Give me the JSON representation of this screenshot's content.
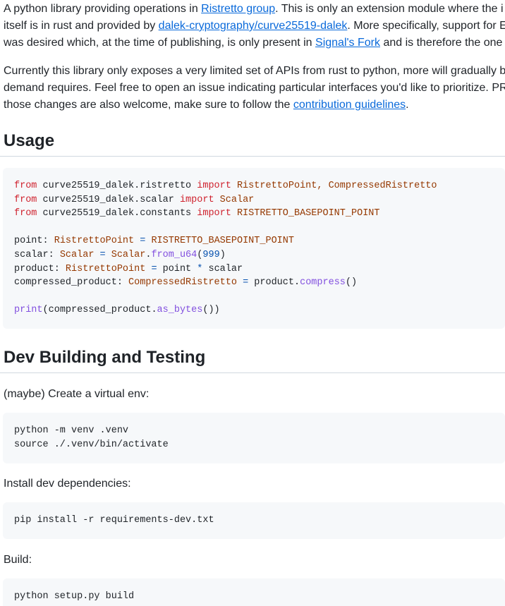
{
  "intro": {
    "p1": {
      "l1_a": "A python library providing operations in ",
      "link_ristretto": "Ristretto group",
      "l1_b": ". This is only an extension module where the i",
      "l2_a": "itself is in rust and provided by ",
      "link_dalek": "dalek-cryptography/curve25519-dalek",
      "l2_b": ". More specifically, support for E",
      "l3_a": "was desired which, at the time of publishing, is only present in ",
      "link_signal": "Signal's Fork",
      "l3_b": " and is therefore the one t"
    },
    "p2": {
      "l1": "Currently this library only exposes a very limited set of APIs from rust to python, more will gradually b",
      "l2": "demand requires. Feel free to open an issue indicating particular interfaces you'd like to prioritize. PRs",
      "l3_a": "those changes are also welcome, make sure to follow the ",
      "link_contrib": "contribution guidelines",
      "l3_b": "."
    }
  },
  "usage": {
    "heading": "Usage",
    "code": {
      "l1": {
        "from": "from",
        "mod": " curve25519_dalek.ristretto ",
        "imp": "import",
        "names": " RistrettoPoint, CompressedRistretto"
      },
      "l2": {
        "from": "from",
        "mod": " curve25519_dalek.scalar ",
        "imp": "import",
        "names": " Scalar"
      },
      "l3": {
        "from": "from",
        "mod": " curve25519_dalek.constants ",
        "imp": "import",
        "names": " RISTRETTO_BASEPOINT_POINT"
      },
      "l5": {
        "var": "point",
        "colon": ": ",
        "type": "RistrettoPoint",
        "eq": " = ",
        "val": "RISTRETTO_BASEPOINT_POINT"
      },
      "l6": {
        "var": "scalar",
        "colon": ": ",
        "type": "Scalar",
        "eq": " = ",
        "obj": "Scalar",
        "dot": ".",
        "fn": "from_u64",
        "open": "(",
        "num": "999",
        "close": ")"
      },
      "l7": {
        "var": "product",
        "colon": ": ",
        "type": "RistrettoPoint",
        "eq": " = ",
        "a": "point ",
        "mul": "*",
        "b": " scalar"
      },
      "l8": {
        "var": "compressed_product",
        "colon": ": ",
        "type": "CompressedRistretto",
        "eq": " = ",
        "obj": "product.",
        "fn": "compress",
        "args": "()"
      },
      "l10": {
        "fn": "print",
        "open": "(compressed_product.",
        "fn2": "as_bytes",
        "close": "())"
      }
    }
  },
  "dev": {
    "heading": "Dev Building and Testing",
    "step1": "(maybe) Create a virtual env:",
    "code1": {
      "l1": "python -m venv .venv",
      "l2": "source ./.venv/bin/activate"
    },
    "step2": "Install dev dependencies:",
    "code2": {
      "l1": "pip install -r requirements-dev.txt"
    },
    "step3": "Build:",
    "code3": {
      "l1": "python setup.py build"
    }
  },
  "colors": {
    "link": "#0969da",
    "keyword": "#cf222e",
    "type": "#953800",
    "constant": "#0550ae",
    "function": "#8250df",
    "code_bg": "#f6f8fa"
  }
}
